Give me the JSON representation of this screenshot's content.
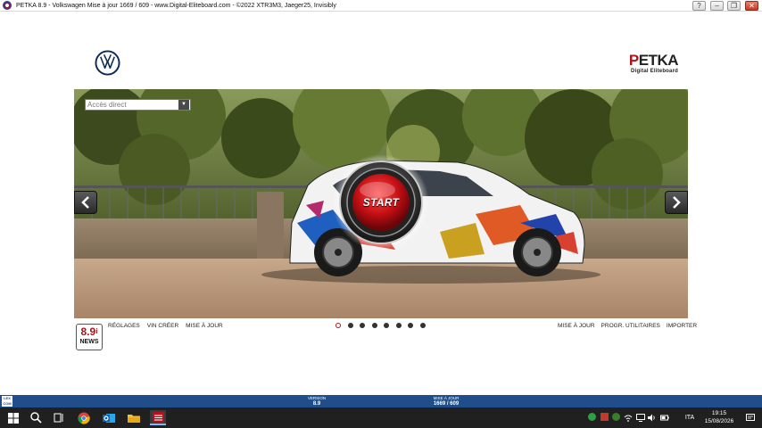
{
  "window": {
    "title": "PETKA 8.9 - Volkswagen Mise à jour 1669 / 609 -  www.Digital-Eliteboard.com - ©2022 XTR3M3, Jaeger25, Invisibly",
    "controls": [
      "?",
      "–",
      "❐",
      "✕"
    ]
  },
  "logo": {
    "petka_p": "P",
    "petka_rest": "ETKA",
    "subtitle": "Digital Eliteboard"
  },
  "search": {
    "placeholder": "Accès direct"
  },
  "start": {
    "label": "START"
  },
  "news": {
    "version": "8.9",
    "sup": "i",
    "label": "NEWS"
  },
  "links_left": [
    "Réglages",
    "VIN créer",
    "Mise à jour"
  ],
  "links_right": [
    "Mise à jour",
    "Progr. utilitaires",
    "Importer"
  ],
  "carousel": {
    "count": 8,
    "active": 0
  },
  "statusbar": {
    "lexcom": "LEX COM",
    "version_label": "VERSION",
    "version_value": "8.9",
    "update_label": "MISE À JOUR",
    "update_value": "1669 / 609"
  },
  "taskbar": {
    "lang": "ITA",
    "time": "19:15",
    "date": "15/08/2026"
  },
  "colors": {
    "brand_red": "#b3121b",
    "status_blue": "#1f4e8a",
    "taskbar": "#202020"
  }
}
